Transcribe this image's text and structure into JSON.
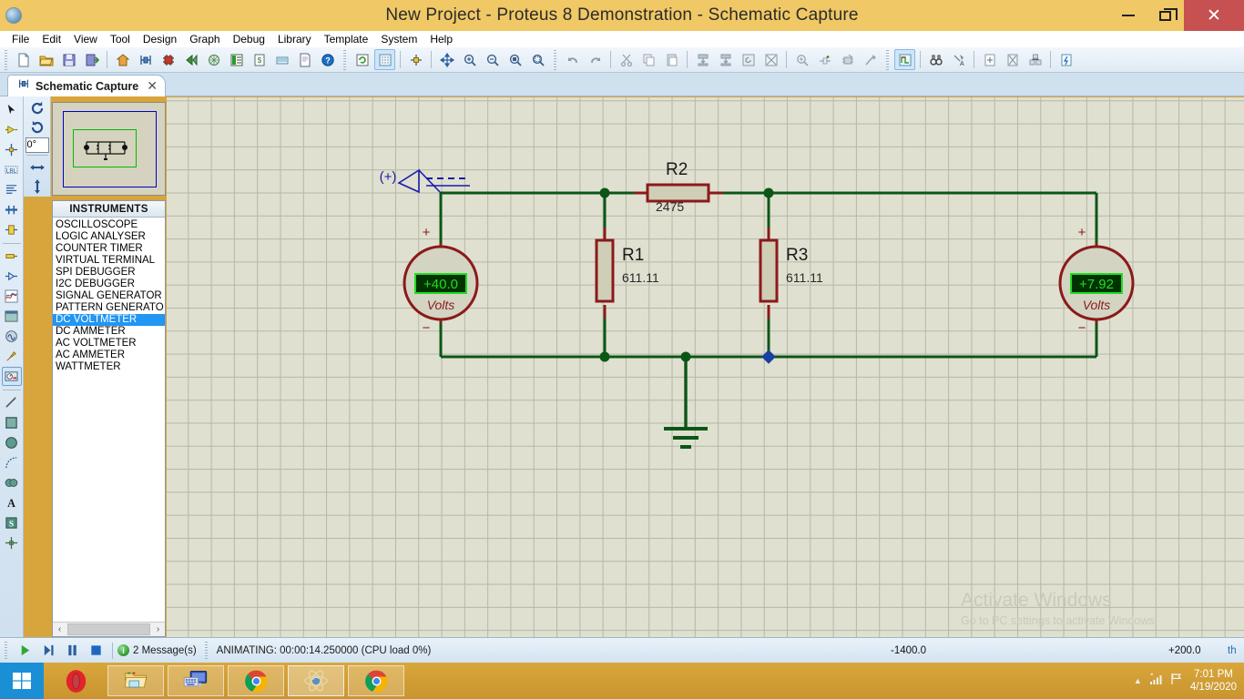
{
  "window": {
    "title": "New Project - Proteus 8 Demonstration - Schematic Capture",
    "app_icon": "proteus-icon",
    "minimize": "–",
    "maximize": "❐",
    "close": "✕"
  },
  "menubar": {
    "items": [
      {
        "label": "File"
      },
      {
        "label": "Edit"
      },
      {
        "label": "View"
      },
      {
        "label": "Tool"
      },
      {
        "label": "Design"
      },
      {
        "label": "Graph"
      },
      {
        "label": "Debug"
      },
      {
        "label": "Library"
      },
      {
        "label": "Template"
      },
      {
        "label": "System"
      },
      {
        "label": "Help"
      }
    ]
  },
  "toolbar": {
    "groups": [
      {
        "name": "file",
        "buttons": [
          {
            "name": "new-project-icon",
            "glyph": "page"
          },
          {
            "name": "open-project-icon",
            "glyph": "folder"
          },
          {
            "name": "save-project-icon",
            "glyph": "floppy"
          },
          {
            "name": "import-export-icon",
            "glyph": "export"
          }
        ]
      },
      {
        "name": "modules",
        "buttons": [
          {
            "name": "home-page-icon",
            "glyph": "home"
          },
          {
            "name": "schematic-capture-icon",
            "glyph": "schematic"
          },
          {
            "name": "pcb-layout-icon",
            "glyph": "chip"
          },
          {
            "name": "3d-visualizer-icon",
            "glyph": "threed"
          },
          {
            "name": "gerber-view-icon",
            "glyph": "gerber"
          },
          {
            "name": "design-explorer-icon",
            "glyph": "explorer"
          },
          {
            "name": "bill-of-materials-icon",
            "glyph": "bom"
          },
          {
            "name": "project-notes-icon",
            "glyph": "notes"
          },
          {
            "name": "report-icon",
            "glyph": "report"
          },
          {
            "name": "help-icon",
            "glyph": "help"
          }
        ]
      },
      {
        "name": "view",
        "buttons": [
          {
            "name": "refresh-display-icon",
            "glyph": "refresh"
          },
          {
            "name": "toggle-grid-icon",
            "glyph": "grid",
            "active": true
          },
          {
            "name": "set-origin-icon",
            "glyph": "origin"
          },
          {
            "name": "pan-icon",
            "glyph": "pan"
          },
          {
            "name": "zoom-in-icon",
            "glyph": "zoomin"
          },
          {
            "name": "zoom-out-icon",
            "glyph": "zoomout"
          },
          {
            "name": "zoom-to-view-icon",
            "glyph": "zoomview"
          },
          {
            "name": "zoom-to-area-icon",
            "glyph": "zoomarea"
          }
        ]
      },
      {
        "name": "edit",
        "buttons": [
          {
            "name": "undo-icon",
            "glyph": "undo"
          },
          {
            "name": "redo-icon",
            "glyph": "redo"
          },
          {
            "name": "cut-icon",
            "glyph": "cut"
          },
          {
            "name": "copy-icon",
            "glyph": "copy"
          },
          {
            "name": "paste-icon",
            "glyph": "paste"
          },
          {
            "name": "block-copy-icon",
            "glyph": "blockcopy"
          },
          {
            "name": "block-move-icon",
            "glyph": "blockmove"
          },
          {
            "name": "block-rotate-icon",
            "glyph": "blockrotate"
          },
          {
            "name": "block-delete-icon",
            "glyph": "blockdelete"
          },
          {
            "name": "pick-device-icon",
            "glyph": "pickdevice"
          },
          {
            "name": "make-device-icon",
            "glyph": "makedevice"
          },
          {
            "name": "packaging-tool-icon",
            "glyph": "package"
          },
          {
            "name": "decompose-icon",
            "glyph": "decompose"
          }
        ]
      },
      {
        "name": "design",
        "buttons": [
          {
            "name": "wire-autorouter-icon",
            "glyph": "autoroute",
            "active": true
          },
          {
            "name": "search-and-tag-icon",
            "glyph": "binoculars"
          },
          {
            "name": "property-assignment-icon",
            "glyph": "propassign"
          },
          {
            "name": "new-sheet-icon",
            "glyph": "newsheet"
          },
          {
            "name": "remove-sheet-icon",
            "glyph": "removesheet"
          },
          {
            "name": "exit-sheet-icon",
            "glyph": "exitsheet"
          },
          {
            "name": "design-explorer-2-icon",
            "glyph": "designexp"
          }
        ]
      }
    ]
  },
  "tab": {
    "label": "Schematic Capture",
    "icon": "schematic-icon",
    "close": "✕"
  },
  "left_toolbar": {
    "items": [
      {
        "name": "selection-mode-icon",
        "glyph": "arrow"
      },
      {
        "name": "component-mode-icon",
        "glyph": "component"
      },
      {
        "name": "junction-dot-mode-icon",
        "glyph": "junction"
      },
      {
        "name": "wire-label-mode-icon",
        "glyph": "lbl"
      },
      {
        "name": "text-script-mode-icon",
        "glyph": "script"
      },
      {
        "name": "buses-mode-icon",
        "glyph": "bus"
      },
      {
        "name": "subcircuit-mode-icon",
        "glyph": "subcircuit"
      },
      {
        "name": "terminals-mode-icon",
        "glyph": "terminal"
      },
      {
        "name": "device-pins-mode-icon",
        "glyph": "devicepin"
      },
      {
        "name": "graph-mode-icon",
        "glyph": "graph"
      },
      {
        "name": "tape-recorder-mode-icon",
        "glyph": "tape"
      },
      {
        "name": "generator-mode-icon",
        "glyph": "generator"
      },
      {
        "name": "voltage-probe-mode-icon",
        "glyph": "probe"
      },
      {
        "name": "virtual-instruments-mode-icon",
        "glyph": "instrument",
        "active": true
      },
      {
        "name": "line-tool-icon",
        "glyph": "line"
      },
      {
        "name": "box-tool-icon",
        "glyph": "box"
      },
      {
        "name": "circle-tool-icon",
        "glyph": "circle"
      },
      {
        "name": "arc-tool-icon",
        "glyph": "arc"
      },
      {
        "name": "path-tool-icon",
        "glyph": "path"
      },
      {
        "name": "text-tool-icon",
        "glyph": "textA"
      },
      {
        "name": "symbol-tool-icon",
        "glyph": "symbolS"
      },
      {
        "name": "marker-tool-icon",
        "glyph": "marker"
      }
    ]
  },
  "rotation_panel": {
    "rotate_cw": "rotate-clockwise-icon",
    "rotate_ccw": "rotate-counterclockwise-icon",
    "angle_value": "0°",
    "mirror_x": "mirror-horizontal-icon",
    "mirror_y": "mirror-vertical-icon"
  },
  "instruments": {
    "header": "INSTRUMENTS",
    "items": [
      {
        "label": "OSCILLOSCOPE",
        "selected": false
      },
      {
        "label": "LOGIC ANALYSER",
        "selected": false
      },
      {
        "label": "COUNTER TIMER",
        "selected": false
      },
      {
        "label": "VIRTUAL TERMINAL",
        "selected": false
      },
      {
        "label": "SPI DEBUGGER",
        "selected": false
      },
      {
        "label": "I2C DEBUGGER",
        "selected": false
      },
      {
        "label": "SIGNAL GENERATOR",
        "selected": false
      },
      {
        "label": "PATTERN GENERATO",
        "selected": false
      },
      {
        "label": "DC VOLTMETER",
        "selected": true
      },
      {
        "label": "DC AMMETER",
        "selected": false
      },
      {
        "label": "AC VOLTMETER",
        "selected": false
      },
      {
        "label": "AC AMMETER",
        "selected": false
      },
      {
        "label": "WATTMETER",
        "selected": false
      }
    ],
    "scroll_left": "‹",
    "scroll_right": "›"
  },
  "circuit": {
    "probe": {
      "label": "(+)",
      "name": "voltage-probe-marker"
    },
    "meter_left": {
      "name": "dc-voltmeter-left",
      "value": "+40.0",
      "unit": "Volts",
      "plus": "+",
      "minus": "−"
    },
    "meter_right": {
      "name": "dc-voltmeter-right",
      "value": "+7.92",
      "unit": "Volts",
      "plus": "+",
      "minus": "−"
    },
    "components": [
      {
        "ref": "R1",
        "value": "611.11",
        "orientation": "vertical"
      },
      {
        "ref": "R2",
        "value": "2475",
        "orientation": "horizontal"
      },
      {
        "ref": "R3",
        "value": "611.11",
        "orientation": "vertical"
      }
    ],
    "ground": {
      "name": "ground-symbol"
    },
    "colors": {
      "wire": "#0b5616",
      "component_outline": "#8b1a1a",
      "component_fill": "#cfcfb8",
      "lcd_bg": "#003300",
      "lcd_text": "#22dd22",
      "canvas_bg": "#dfe0d0",
      "grid_line": "#b6b7a7"
    }
  },
  "watermark": {
    "title": "Activate Windows",
    "subtitle": "Go to PC settings to activate Windows."
  },
  "statusbar": {
    "play": "play-button",
    "step": "step-button",
    "pause": "pause-button",
    "stop": "stop-button",
    "messages_count": "2 Message(s)",
    "messages_icon_char": "i",
    "animating": "ANIMATING: 00:00:14.250000 (CPU load 0%)",
    "coord_x": "-1400.0",
    "coord_y": "+200.0",
    "units": "th"
  },
  "taskbar": {
    "start": "windows-start-icon",
    "items": [
      {
        "name": "opera-taskbar-icon",
        "running": false
      },
      {
        "name": "file-explorer-taskbar-icon",
        "running": true
      },
      {
        "name": "remote-desktop-taskbar-icon",
        "running": true
      },
      {
        "name": "chrome-taskbar-icon",
        "running": true
      },
      {
        "name": "proteus-taskbar-icon",
        "running": true,
        "active": true
      },
      {
        "name": "chrome-2-taskbar-icon",
        "running": true
      }
    ],
    "tray": {
      "show_hidden": "▲",
      "network_icon": "network-signal-icon",
      "action_center_icon": "flag-icon",
      "time": "7:01 PM",
      "date": "4/19/2020"
    }
  }
}
